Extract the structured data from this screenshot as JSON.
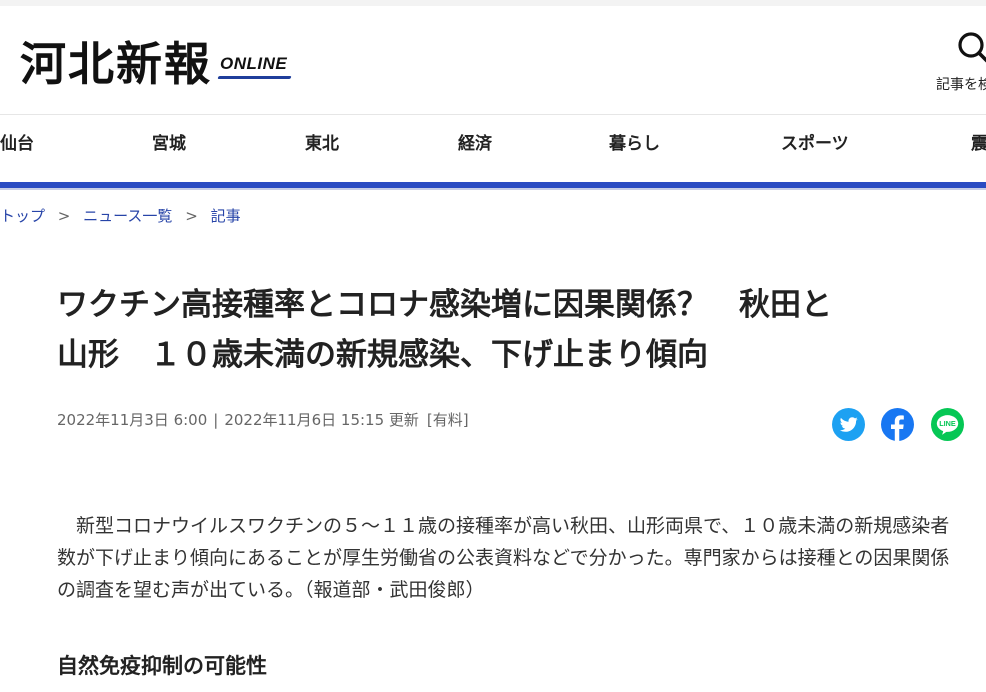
{
  "header": {
    "logo_kanji": "河北新報",
    "logo_sub": "ONLINE",
    "search_label": "記事を検"
  },
  "nav": {
    "items": [
      "仙台",
      "宮城",
      "東北",
      "経済",
      "暮らし",
      "スポーツ",
      "震"
    ]
  },
  "breadcrumb": {
    "items": [
      "トップ",
      "ニュース一覧",
      "記事"
    ],
    "separator": ">"
  },
  "article": {
    "title_line1": "ワクチン高接種率とコロナ感染増に因果関係？　秋田と",
    "title_line2": "山形　１０歳未満の新規感染、下げ止まり傾向",
    "published": "2022年11月3日 6:00",
    "meta_separator": "|",
    "updated": "2022年11月6日 15:15 更新",
    "badge": "[有料]",
    "lead": "新型コロナウイルスワクチンの５～１１歳の接種率が高い秋田、山形両県で、１０歳未満の新規感染者数が下げ止まり傾向にあることが厚生労働省の公表資料などで分かった。専門家からは接種との因果関係の調査を望む声が出ている。（報道部・武田俊郎）",
    "subheading": "自然免疫抑制の可能性"
  },
  "share": {
    "twitter_color": "#1da1f2",
    "facebook_color": "#1877f2",
    "line_color": "#06c755",
    "line_text": "LINE"
  },
  "colors": {
    "accent": "#2a4bc2",
    "link": "#2744a8"
  }
}
